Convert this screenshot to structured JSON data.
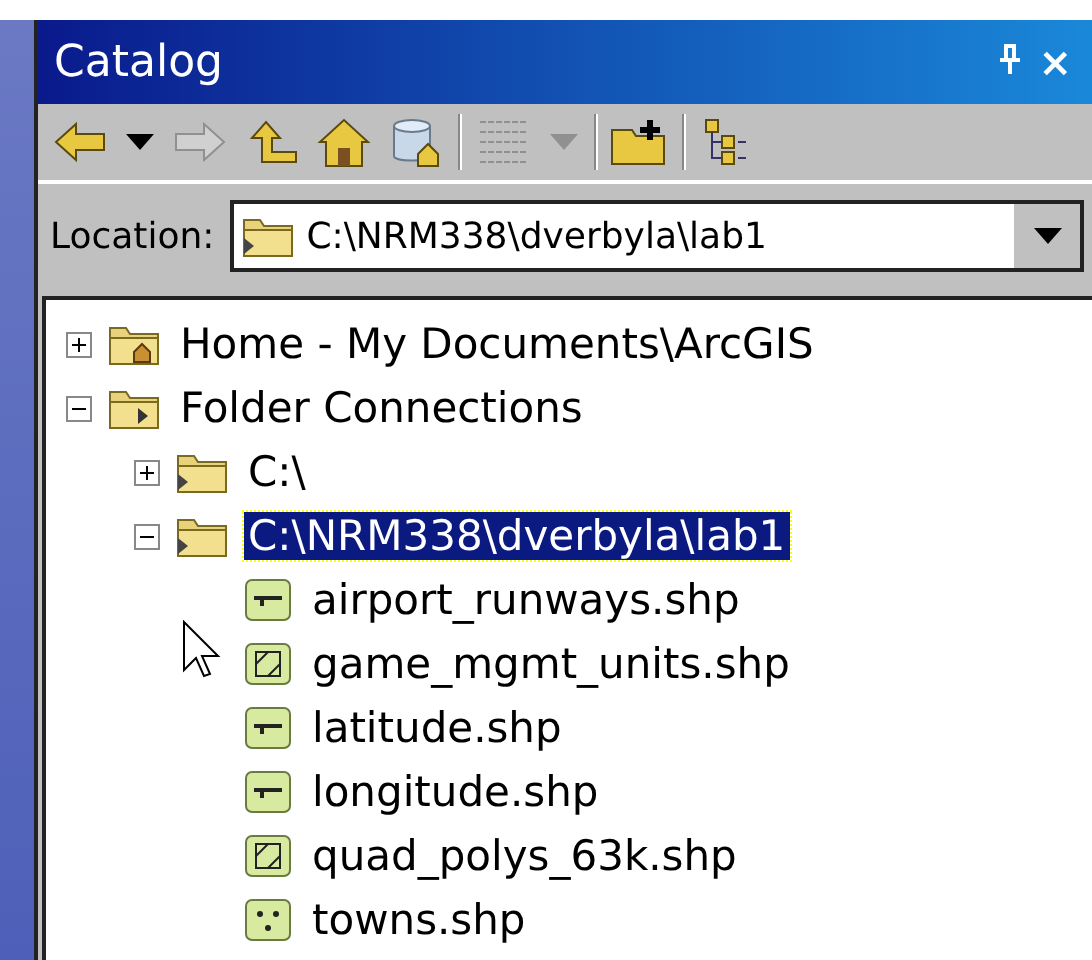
{
  "window": {
    "title": "Catalog",
    "close": "×"
  },
  "toolbar": [
    {
      "kind": "back",
      "disabled": false
    },
    {
      "kind": "dropdown",
      "disabled": false
    },
    {
      "kind": "forward",
      "disabled": true
    },
    {
      "kind": "up",
      "disabled": false
    },
    {
      "kind": "home",
      "disabled": false
    },
    {
      "kind": "database",
      "disabled": false
    },
    {
      "kind": "separator"
    },
    {
      "kind": "table",
      "disabled": true
    },
    {
      "kind": "dropdown",
      "disabled": true
    },
    {
      "kind": "separator"
    },
    {
      "kind": "new-folder",
      "disabled": false
    },
    {
      "kind": "separator"
    },
    {
      "kind": "tree",
      "disabled": false
    }
  ],
  "location": {
    "label": "Location:",
    "value": "C:\\NRM338\\dverbyla\\lab1"
  },
  "tree": [
    {
      "label": "Home - My Documents\\ArcGIS",
      "kind": "home-folder",
      "expanded": false,
      "selected": false
    },
    {
      "label": "Folder Connections",
      "kind": "connections",
      "expanded": true,
      "selected": false,
      "children": [
        {
          "label": "C:\\",
          "kind": "folder",
          "expanded": false,
          "selected": false
        },
        {
          "label": "C:\\NRM338\\dverbyla\\lab1",
          "kind": "folder",
          "expanded": true,
          "selected": true,
          "children": [
            {
              "label": "airport_runways.shp",
              "kind": "line",
              "selected": false
            },
            {
              "label": "game_mgmt_units.shp",
              "kind": "polygon",
              "selected": false
            },
            {
              "label": "latitude.shp",
              "kind": "line",
              "selected": false
            },
            {
              "label": "longitude.shp",
              "kind": "line",
              "selected": false
            },
            {
              "label": "quad_polys_63k.shp",
              "kind": "polygon",
              "selected": false
            },
            {
              "label": "towns.shp",
              "kind": "point",
              "selected": false
            }
          ]
        }
      ]
    }
  ]
}
